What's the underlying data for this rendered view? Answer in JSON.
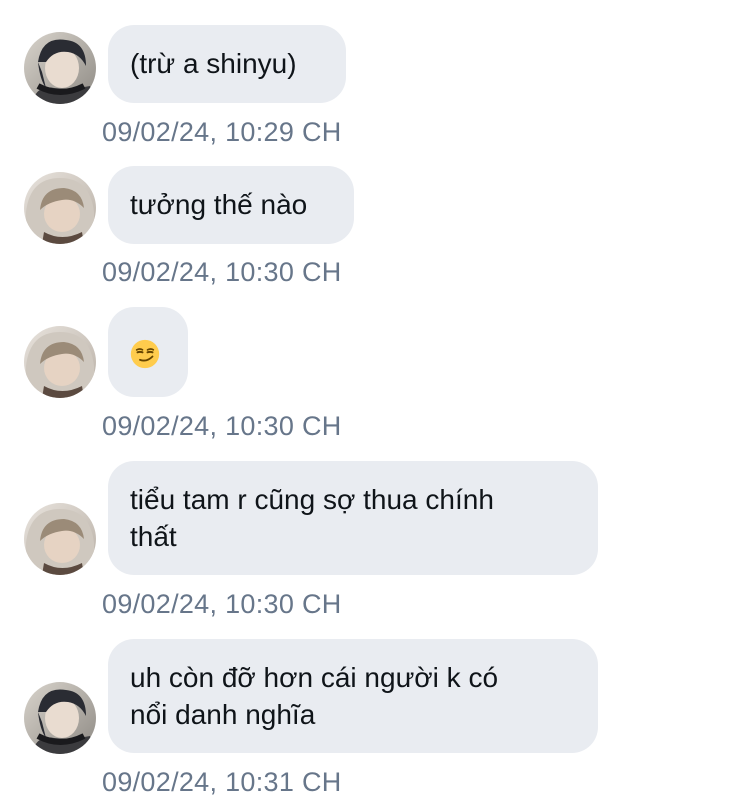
{
  "messages": [
    {
      "text": "(trừ a shinyu)",
      "timestamp": "09/02/24, 10:29 CH",
      "avatar": "avatar-dark-hair-headphones"
    },
    {
      "text": "tưởng thế nào",
      "timestamp": "09/02/24, 10:30 CH",
      "avatar": "avatar-light-hair-hood"
    },
    {
      "text": "😏",
      "timestamp": "09/02/24, 10:30 CH",
      "avatar": "avatar-light-hair-hood"
    },
    {
      "text_line1": "tiểu tam r cũng sợ thua chính",
      "text_line2": "thất",
      "timestamp": "09/02/24, 10:30 CH",
      "avatar": "avatar-light-hair-hood"
    },
    {
      "text_line1": "uh còn đỡ hơn cái người k có",
      "text_line2": "nổi danh nghĩa",
      "timestamp": "09/02/24, 10:31 CH",
      "avatar": "avatar-dark-hair-headphones"
    }
  ],
  "colors": {
    "bubble": "#e9ecf1",
    "text": "#0f1419",
    "timestamp": "#67768a"
  },
  "icons": {
    "emoji": "smirking-face-emoji"
  }
}
